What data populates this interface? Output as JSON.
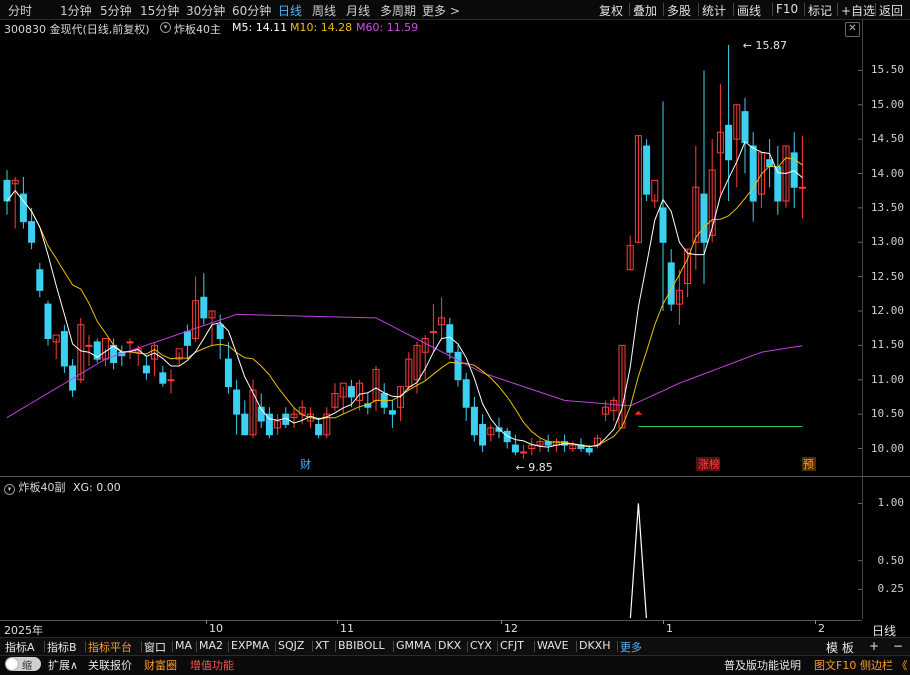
{
  "toolbar": {
    "periods": [
      "分时",
      "1分钟",
      "5分钟",
      "15分钟",
      "30分钟",
      "60分钟",
      "日线",
      "周线",
      "月线",
      "多周期",
      "更多 >"
    ],
    "active_period": "日线",
    "right_buttons": [
      "复权",
      "叠加",
      "多股",
      "统计",
      "画线",
      "F10",
      "标记",
      "+自选",
      "返回"
    ]
  },
  "info": {
    "code_name": "300830 金现代(日线,前复权)",
    "indicator": "炸板40主",
    "ma5": "M5: 14.11",
    "ma10": "M10: 14.28",
    "ma60": "M60: 11.59"
  },
  "price_axis": [
    "15.50",
    "15.00",
    "14.50",
    "14.00",
    "13.50",
    "13.00",
    "12.50",
    "12.00",
    "11.50",
    "11.00",
    "10.50",
    "10.00"
  ],
  "annotations": {
    "high": "15.87",
    "low": "9.85",
    "marker_cai": "财",
    "marker_zhangbang": "涨榜",
    "marker_yu": "预"
  },
  "sub": {
    "title": "炸板40副",
    "value": "XG: 0.00",
    "axis": [
      "1.00",
      "0.50",
      "0.25"
    ]
  },
  "x_axis": [
    "2025年",
    "10",
    "11",
    "12",
    "1",
    "2"
  ],
  "corner": {
    "period": "日线",
    "plus": "+",
    "minus": "−",
    "mode": "模 板"
  },
  "bottom_row1": [
    "指标A",
    "指标B",
    "指标平台",
    "窗口",
    "MA",
    "MA2",
    "EXPMA",
    "SQJZ",
    "XT",
    "BBIBOLL",
    "GMMA",
    "DKX",
    "CYX",
    "CFJT",
    "WAVE",
    "DKXH",
    "更多"
  ],
  "bottom_row2": {
    "toggle": "缩",
    "items": [
      "扩展∧",
      "关联报价",
      "财富圈",
      "增值功能"
    ],
    "right": "普及版功能说明",
    "right2": "图文F10",
    "right3": "侧边栏 《"
  },
  "colors": {
    "up": "#ff3c3c",
    "down": "#3cd0f0",
    "ma5": "#ffffff",
    "ma10": "#e8c000",
    "ma60": "#c040e0",
    "accent": "#4fb6ff"
  },
  "chart_data": {
    "type": "candlestick",
    "ylim": [
      9.6,
      16.0
    ],
    "candles": [
      [
        13.9,
        14.05,
        13.6,
        13.4
      ],
      [
        13.85,
        13.95,
        13.9,
        13.2
      ],
      [
        13.7,
        13.95,
        13.3,
        13.2
      ],
      [
        13.3,
        13.5,
        13.0,
        12.9
      ],
      [
        12.6,
        12.7,
        12.3,
        12.2
      ],
      [
        12.1,
        12.15,
        11.6,
        11.5
      ],
      [
        11.55,
        11.6,
        11.65,
        11.3
      ],
      [
        11.7,
        11.8,
        11.2,
        11.1
      ],
      [
        11.2,
        11.3,
        10.85,
        10.75
      ],
      [
        11.0,
        11.9,
        11.8,
        10.95
      ],
      [
        11.5,
        11.65,
        11.5,
        11.2
      ],
      [
        11.55,
        11.6,
        11.3,
        11.25
      ],
      [
        11.3,
        11.45,
        11.6,
        11.2
      ],
      [
        11.5,
        11.6,
        11.25,
        11.15
      ],
      [
        11.4,
        11.5,
        11.35,
        11.2
      ],
      [
        11.55,
        11.6,
        11.55,
        11.3
      ],
      [
        11.4,
        11.5,
        11.45,
        11.2
      ],
      [
        11.2,
        11.35,
        11.1,
        11.0
      ],
      [
        11.3,
        11.55,
        11.5,
        11.05
      ],
      [
        11.1,
        11.2,
        10.95,
        10.9
      ],
      [
        11.0,
        11.15,
        11.0,
        10.8
      ],
      [
        11.3,
        11.4,
        11.45,
        11.2
      ],
      [
        11.7,
        11.8,
        11.5,
        11.3
      ],
      [
        11.6,
        12.5,
        12.15,
        11.55
      ],
      [
        12.2,
        12.55,
        11.9,
        11.8
      ],
      [
        11.9,
        12.0,
        12.0,
        11.5
      ],
      [
        11.8,
        11.95,
        11.6,
        11.3
      ],
      [
        11.3,
        11.55,
        10.9,
        10.8
      ],
      [
        10.85,
        11.0,
        10.5,
        10.2
      ],
      [
        10.5,
        10.7,
        10.2,
        10.2
      ],
      [
        10.2,
        11.0,
        10.85,
        10.15
      ],
      [
        10.6,
        10.8,
        10.4,
        10.3
      ],
      [
        10.5,
        10.6,
        10.2,
        10.15
      ],
      [
        10.3,
        10.5,
        10.4,
        10.2
      ],
      [
        10.5,
        10.6,
        10.35,
        10.3
      ],
      [
        10.45,
        10.6,
        10.5,
        10.3
      ],
      [
        10.5,
        10.7,
        10.6,
        10.35
      ],
      [
        10.4,
        10.6,
        10.5,
        10.3
      ],
      [
        10.35,
        10.45,
        10.2,
        10.15
      ],
      [
        10.2,
        10.6,
        10.5,
        10.15
      ],
      [
        10.6,
        10.95,
        10.8,
        10.55
      ],
      [
        10.75,
        10.9,
        10.95,
        10.5
      ],
      [
        10.9,
        11.0,
        10.75,
        10.6
      ],
      [
        10.7,
        11.0,
        10.95,
        10.55
      ],
      [
        10.65,
        10.8,
        10.6,
        10.5
      ],
      [
        10.7,
        11.2,
        11.15,
        10.55
      ],
      [
        10.8,
        10.95,
        10.6,
        10.5
      ],
      [
        10.55,
        10.7,
        10.5,
        10.3
      ],
      [
        10.6,
        10.9,
        10.9,
        10.4
      ],
      [
        10.9,
        11.4,
        11.3,
        10.85
      ],
      [
        11.0,
        11.55,
        11.5,
        10.8
      ],
      [
        11.4,
        11.65,
        11.6,
        11.0
      ],
      [
        11.7,
        12.1,
        11.7,
        11.4
      ],
      [
        11.8,
        12.2,
        11.9,
        11.6
      ],
      [
        11.8,
        11.9,
        11.4,
        11.3
      ],
      [
        11.4,
        11.5,
        11.0,
        10.9
      ],
      [
        11.0,
        11.1,
        10.6,
        10.4
      ],
      [
        10.6,
        10.75,
        10.2,
        10.1
      ],
      [
        10.35,
        10.5,
        10.05,
        9.95
      ],
      [
        10.2,
        10.35,
        10.3,
        10.1
      ],
      [
        10.3,
        10.45,
        10.25,
        10.15
      ],
      [
        10.25,
        10.3,
        10.1,
        10.0
      ],
      [
        10.05,
        10.2,
        9.95,
        9.9
      ],
      [
        9.95,
        10.05,
        9.95,
        9.85
      ],
      [
        10.0,
        10.15,
        10.05,
        9.9
      ],
      [
        10.05,
        10.15,
        10.1,
        9.95
      ],
      [
        10.1,
        10.2,
        10.05,
        9.95
      ],
      [
        10.05,
        10.15,
        10.1,
        9.95
      ],
      [
        10.1,
        10.2,
        10.05,
        9.95
      ],
      [
        10.0,
        10.1,
        10.05,
        9.95
      ],
      [
        10.05,
        10.15,
        10.0,
        9.95
      ],
      [
        10.0,
        10.05,
        9.95,
        9.9
      ],
      [
        10.05,
        10.2,
        10.15,
        10.0
      ],
      [
        10.5,
        10.7,
        10.6,
        10.4
      ],
      [
        10.55,
        10.75,
        10.7,
        10.4
      ],
      [
        10.3,
        11.5,
        11.5,
        10.3
      ],
      [
        12.6,
        13.1,
        12.95,
        12.6
      ],
      [
        13.0,
        14.55,
        14.55,
        13.0
      ],
      [
        14.4,
        14.5,
        13.7,
        13.6
      ],
      [
        13.6,
        13.7,
        13.9,
        13.5
      ],
      [
        13.5,
        15.05,
        13.0,
        12.0
      ],
      [
        12.7,
        12.9,
        12.1,
        12.0
      ],
      [
        12.1,
        12.6,
        12.3,
        11.8
      ],
      [
        12.4,
        12.9,
        12.9,
        12.2
      ],
      [
        13.0,
        14.4,
        13.8,
        12.6
      ],
      [
        13.7,
        15.5,
        13.0,
        12.4
      ],
      [
        13.1,
        14.5,
        14.05,
        13.0
      ],
      [
        14.3,
        15.3,
        14.6,
        13.7
      ],
      [
        14.7,
        15.87,
        14.2,
        13.6
      ],
      [
        14.5,
        15.0,
        15.0,
        13.8
      ],
      [
        14.9,
        15.1,
        14.45,
        14.0
      ],
      [
        14.4,
        14.6,
        13.6,
        13.3
      ],
      [
        13.7,
        14.3,
        14.3,
        13.5
      ],
      [
        14.2,
        14.5,
        14.1,
        13.8
      ],
      [
        14.1,
        14.4,
        13.6,
        13.4
      ],
      [
        13.6,
        14.4,
        14.4,
        13.5
      ],
      [
        14.3,
        14.6,
        13.8,
        13.5
      ],
      [
        13.8,
        14.55,
        13.8,
        13.35
      ]
    ],
    "candle_format": "[open, high, close, low]",
    "ma5_label": "M5: 14.11",
    "ma10_label": "M10: 14.28",
    "ma60_label": "M60: 11.59",
    "high": 15.87,
    "low": 9.85,
    "support_line": 10.32,
    "xg_signal_index": 77,
    "sub_ylim": [
      0,
      1.1
    ]
  }
}
